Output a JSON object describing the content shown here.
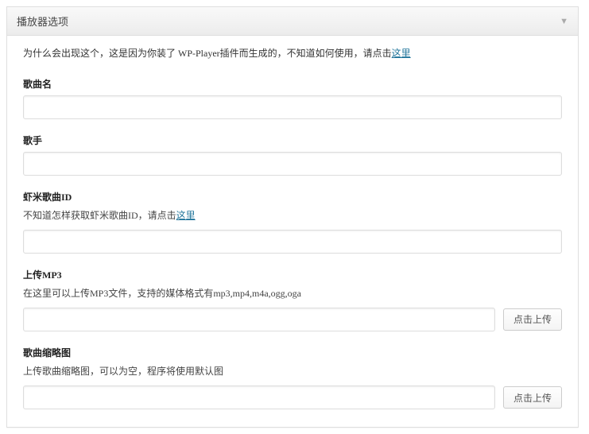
{
  "panel": {
    "title": "播放器选项"
  },
  "intro": {
    "text_before_link": "为什么会出现这个，这是因为你装了 WP-Player插件而生成的，不知道如何使用，请点击",
    "link_text": "这里"
  },
  "fields": {
    "song_name": {
      "label": "歌曲名",
      "value": ""
    },
    "artist": {
      "label": "歌手",
      "value": ""
    },
    "xiami_id": {
      "label": "虾米歌曲ID",
      "hint_before_link": "不知道怎样获取虾米歌曲ID，请点击",
      "hint_link_text": "这里",
      "value": ""
    },
    "upload_mp3": {
      "label": "上传MP3",
      "hint": "在这里可以上传MP3文件，支持的媒体格式有mp3,mp4,m4a,ogg,oga",
      "value": "",
      "button": "点击上传"
    },
    "thumbnail": {
      "label": "歌曲缩略图",
      "hint": "上传歌曲缩略图，可以为空，程序将使用默认图",
      "value": "",
      "button": "点击上传"
    }
  }
}
